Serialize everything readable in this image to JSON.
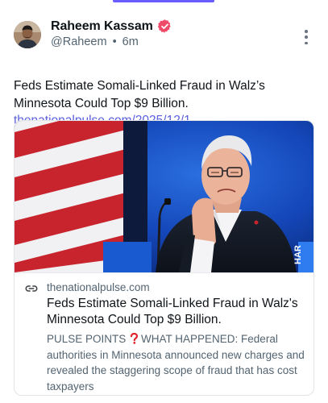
{
  "post": {
    "author": {
      "name": "Raheem Kassam",
      "handle": "@Raheem",
      "separator": "•",
      "time": "6m"
    },
    "text": "Feds Estimate Somali-Linked Fraud in Walz’s Minnesota Could Top $9 Billion. ",
    "link_text": "thenationalpulse.com/2025/12/1...",
    "card": {
      "domain": "thenationalpulse.com",
      "title": "Feds Estimate Somali-Linked Fraud in Walz's Minnesota Could Top $9 Billion.",
      "description_prefix": "PULSE POINTS ",
      "description_rest": "WHAT HAPPENED: Federal authorities in Minnesota announced new charges and revealed the staggering scope of fraud that has cost taxpayers"
    }
  },
  "colors": {
    "accent": "#6a5cff",
    "link": "#5b5fde",
    "verified": "#f04a6a",
    "muted": "#536471",
    "text": "#0f1419"
  },
  "icons": {
    "verified": "verified-badge-icon",
    "more": "more-vertical-icon",
    "link": "link-icon",
    "question": "red-question-mark-icon"
  }
}
